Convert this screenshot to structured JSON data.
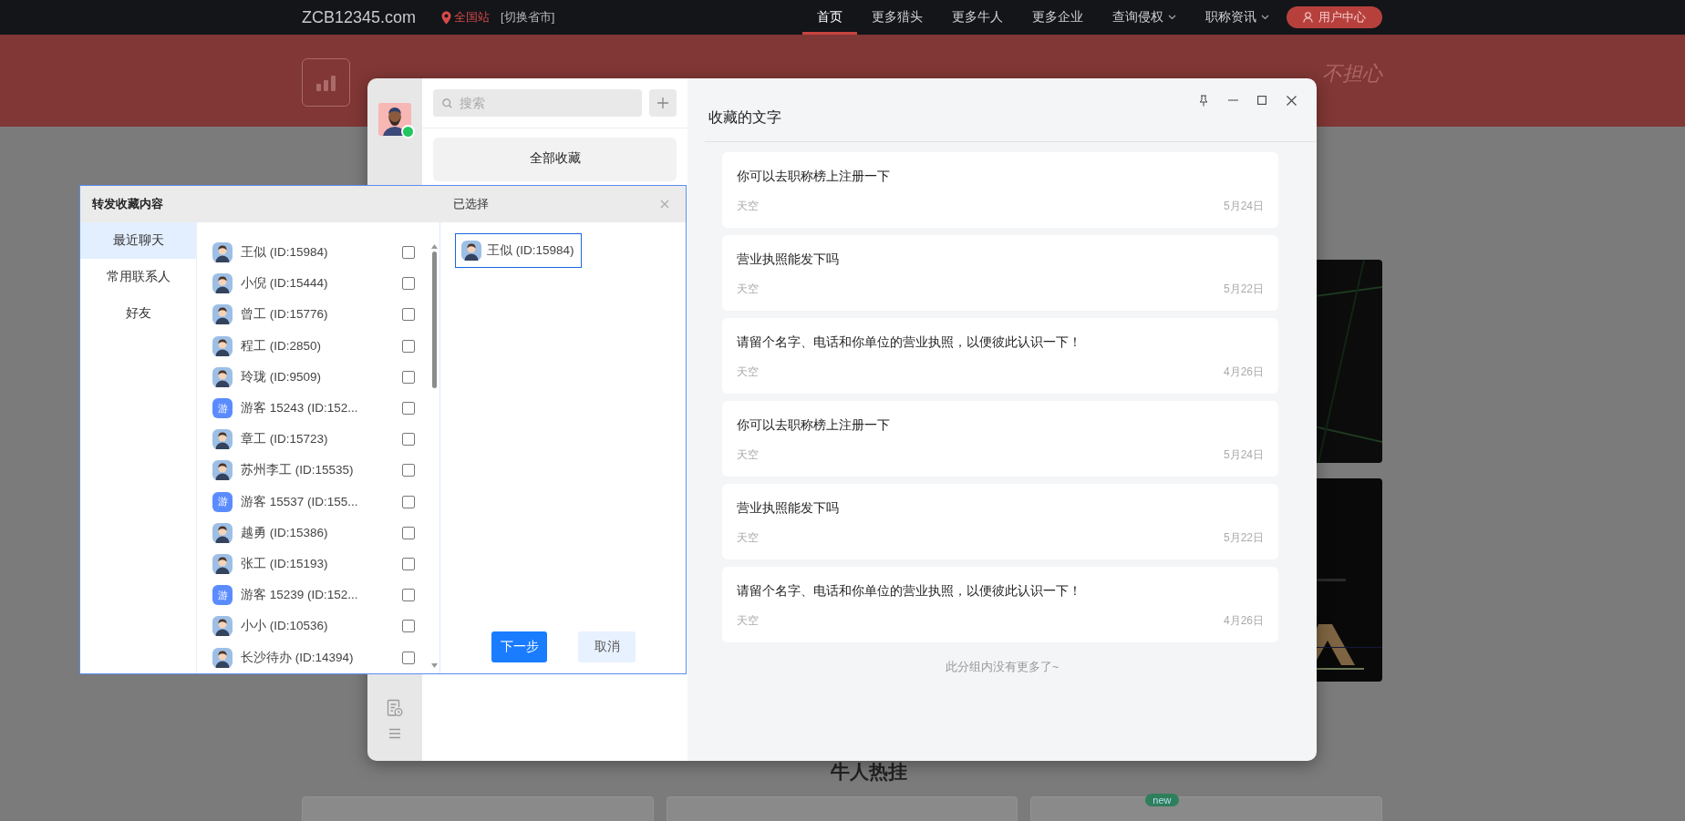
{
  "top_nav": {
    "site": "ZCB12345.com",
    "location": "全国站",
    "switch_region": "[切换省市]",
    "items": [
      {
        "label": "首页",
        "selected": true,
        "dropdown": false
      },
      {
        "label": "更多猎头",
        "selected": false,
        "dropdown": false
      },
      {
        "label": "更多牛人",
        "selected": false,
        "dropdown": false
      },
      {
        "label": "更多企业",
        "selected": false,
        "dropdown": false
      },
      {
        "label": "查询侵权",
        "selected": false,
        "dropdown": true
      },
      {
        "label": "职称资讯",
        "selected": false,
        "dropdown": true
      }
    ],
    "user_button": "用户中心"
  },
  "header": {
    "slogan": "不担心"
  },
  "page": {
    "section_title": "牛人热挂",
    "badge": "new"
  },
  "chat_window": {
    "user": {
      "online": true
    },
    "search": {
      "placeholder": "搜索"
    },
    "group": "全部收藏",
    "title": "收藏的文字",
    "favorites": [
      {
        "text": "你可以去职称榜上注册一下",
        "author": "天空",
        "date": "5月24日"
      },
      {
        "text": "营业执照能发下吗",
        "author": "天空",
        "date": "5月22日"
      },
      {
        "text": "请留个名字、电话和你单位的营业执照，以便彼此认识一下！",
        "author": "天空",
        "date": "4月26日"
      },
      {
        "text": "你可以去职称榜上注册一下",
        "author": "天空",
        "date": "5月24日"
      },
      {
        "text": "营业执照能发下吗",
        "author": "天空",
        "date": "5月22日"
      },
      {
        "text": "请留个名字、电话和你单位的营业执照，以便彼此认识一下！",
        "author": "天空",
        "date": "4月26日"
      }
    ],
    "footer": "此分组内没有更多了~"
  },
  "forward_dialog": {
    "title": "转发收藏内容",
    "selected_title": "已选择",
    "tabs": [
      {
        "label": "最近聊天",
        "selected": true
      },
      {
        "label": "常用联系人",
        "selected": false
      },
      {
        "label": "好友",
        "selected": false
      }
    ],
    "contacts": [
      {
        "name": "王似 (ID:15984)",
        "kind": "person",
        "checked": false
      },
      {
        "name": "小倪 (ID:15444)",
        "kind": "person",
        "checked": false
      },
      {
        "name": "曾工 (ID:15776)",
        "kind": "person",
        "checked": false
      },
      {
        "name": "程工 (ID:2850)",
        "kind": "person",
        "checked": false
      },
      {
        "name": "玲珑 (ID:9509)",
        "kind": "person",
        "checked": false
      },
      {
        "name": "游客 15243 (ID:152...",
        "kind": "guest",
        "avatar_text": "游",
        "checked": false
      },
      {
        "name": "章工 (ID:15723)",
        "kind": "person",
        "checked": false
      },
      {
        "name": "苏州李工 (ID:15535)",
        "kind": "person",
        "checked": false
      },
      {
        "name": "游客 15537 (ID:155...",
        "kind": "guest",
        "avatar_text": "游",
        "checked": false
      },
      {
        "name": "越勇 (ID:15386)",
        "kind": "person",
        "checked": false
      },
      {
        "name": "张工 (ID:15193)",
        "kind": "person",
        "checked": false
      },
      {
        "name": "游客 15239 (ID:152...",
        "kind": "guest",
        "avatar_text": "游",
        "checked": false
      },
      {
        "name": "小小 (ID:10536)",
        "kind": "person",
        "checked": false
      },
      {
        "name": "长沙待办 (ID:14394)",
        "kind": "person",
        "checked": false
      }
    ],
    "selected_contacts": [
      {
        "name": "王似 (ID:15984)",
        "kind": "person"
      }
    ],
    "next_button": "下一步",
    "cancel_button": "取消"
  }
}
